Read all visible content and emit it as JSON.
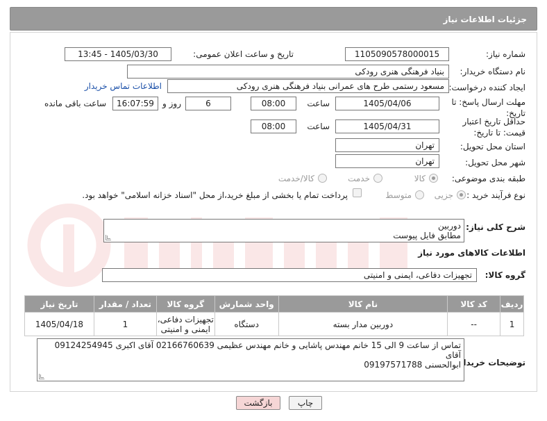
{
  "header": {
    "title": "جزئیات اطلاعات نیاز"
  },
  "form": {
    "need_number_label": "شماره نیاز:",
    "need_number": "1105090578000015",
    "announce_label": "تاریخ و ساعت اعلان عمومی:",
    "announce_value": "1405/03/30 - 13:45",
    "buyer_label": "نام دستگاه خریدار:",
    "buyer_value": "بنیاد فرهنگی هنری رودکی",
    "creator_label": "ایجاد کننده درخواست:",
    "creator_value": "مسعود رستمی طرح های عمرانی بنیاد فرهنگی هنری رودکی",
    "contact_link": "اطلاعات تماس خریدار",
    "deadline_label": "مهلت ارسال پاسخ: تا تاریخ:",
    "deadline_date": "1405/04/06",
    "time_label": "ساعت",
    "deadline_time": "08:00",
    "days_value": "6",
    "days_label": "روز و",
    "remaining_time": "16:07:59",
    "remaining_label": "ساعت باقی مانده",
    "validity_label": "حداقل تاریخ اعتبار قیمت: تا تاریخ:",
    "validity_date": "1405/04/31",
    "validity_time": "08:00",
    "province_label": "استان محل تحویل:",
    "province_value": "تهران",
    "city_label": "شهر محل تحویل:",
    "city_value": "تهران",
    "category_label": "طبقه بندی موضوعی:",
    "category_options": {
      "goods": "کالا",
      "service": "خدمت",
      "goods_service": "کالا/خدمت"
    },
    "process_label": "نوع فرآیند خرید :",
    "process_options": {
      "partial": "جزیی",
      "medium": "متوسط"
    },
    "payment_note": "پرداخت تمام یا بخشی از مبلغ خرید،از محل \"اسناد خزانه اسلامی\" خواهد بود.",
    "description_label": "شرح کلی نیاز:",
    "description_line1": "دوربین",
    "description_line2": "مطابق فایل پیوست",
    "goods_info_title": "اطلاعات کالاهای مورد نیاز",
    "goods_group_label": "گروه کالا:",
    "goods_group_value": "تجهیزات دفاعی، ایمنی و امنیتی"
  },
  "table": {
    "headers": [
      "ردیف",
      "کد کالا",
      "نام کالا",
      "واحد شمارش",
      "گروه کالا",
      "تعداد / مقدار",
      "تاریخ نیاز"
    ],
    "rows": [
      [
        "1",
        "--",
        "دوربین مدار بسته",
        "دستگاه",
        "تجهیزات دفاعی، ایمنی و امنیتی",
        "1",
        "1405/04/18"
      ]
    ]
  },
  "buyer_notes": {
    "label": "توضیحات خریدار:",
    "line1": "تماس از ساعت 9 الی 15 خانم مهندس پاشایی و خانم مهندس عظیمی    02166760639 آقای اکبری 09124254945 آقای",
    "line2": "ابوالحسنی 09197571788"
  },
  "buttons": {
    "print": "چاپ",
    "back": "بازگشت"
  },
  "colors": {
    "header": "#9a9a9a",
    "link": "#1a4fa8",
    "back_button": "#f6d6d6",
    "print_button": "#f3f3f3"
  }
}
